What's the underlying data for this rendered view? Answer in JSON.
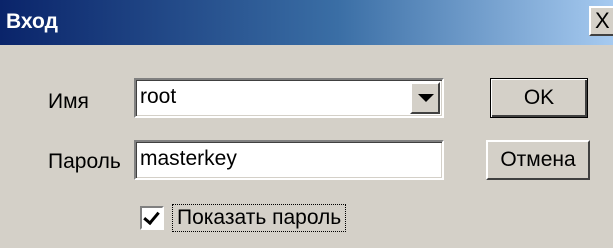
{
  "window": {
    "title": "Вход",
    "close_glyph": "X"
  },
  "form": {
    "name_label": "Имя",
    "name_value": "root",
    "password_label": "Пароль",
    "password_value": "masterkey",
    "show_password_label": "Показать пароль",
    "show_password_checked": true
  },
  "buttons": {
    "ok_label": "OK",
    "cancel_label": "Отмена"
  },
  "icons": {
    "close": "close-icon",
    "dropdown": "chevron-down-icon",
    "check": "checkmark-icon"
  }
}
